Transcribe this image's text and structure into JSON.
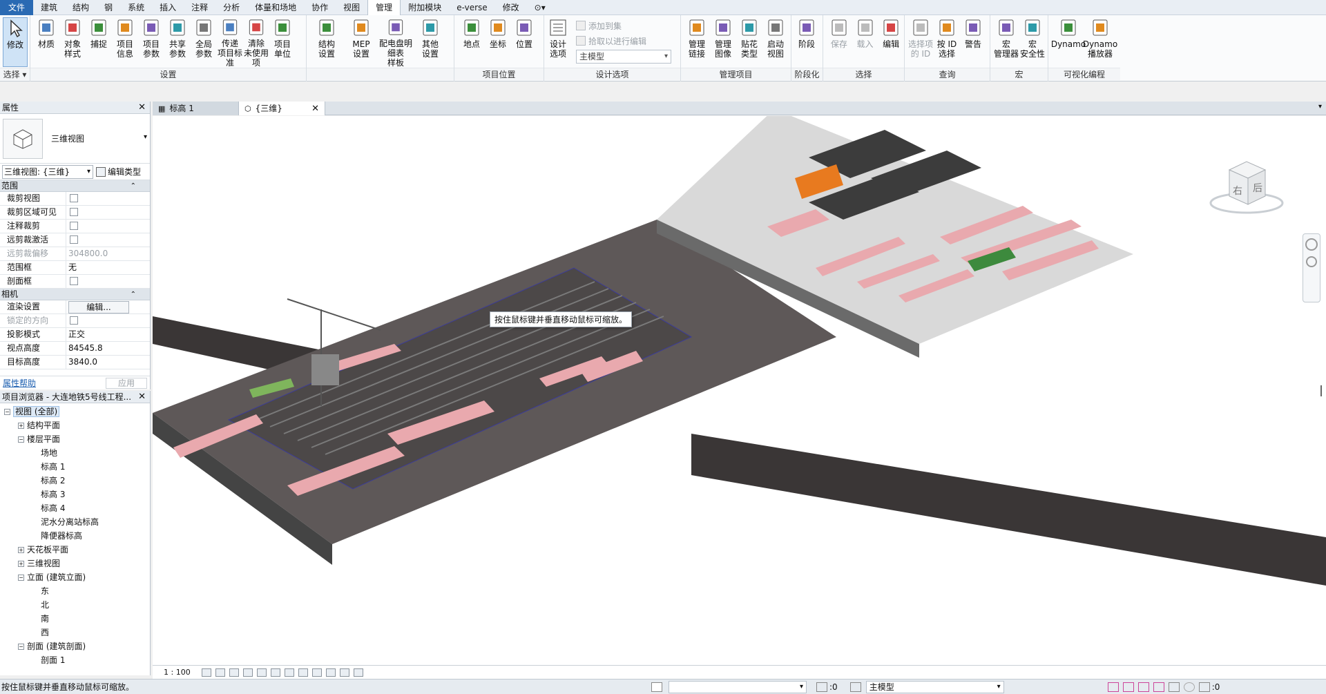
{
  "menu": [
    "文件",
    "建筑",
    "结构",
    "钢",
    "系统",
    "插入",
    "注释",
    "分析",
    "体量和场地",
    "协作",
    "视图",
    "管理",
    "附加模块",
    "e-verse",
    "修改"
  ],
  "menu_active": "管理",
  "ribbon": {
    "select_panel": {
      "tool": "修改",
      "title": "选择"
    },
    "settings_panel": {
      "title": "设置",
      "tools": [
        "材质",
        "对象\n样式",
        "捕捉",
        "项目\n信息",
        "项目\n参数",
        "共享\n参数",
        "全局\n参数",
        "传递\n项目标准",
        "清除\n未使用项",
        "项目\n单位"
      ]
    },
    "mep_panel": {
      "tools": [
        "结构\n设置",
        "MEP\n设置",
        "配电盘明细表\n样板",
        "其他\n设置"
      ]
    },
    "location_panel": {
      "title": "项目位置",
      "tools": [
        "地点",
        "坐标",
        "位置"
      ]
    },
    "design_panel": {
      "title": "设计选项",
      "tool": "设计\n选项",
      "add_to_set": "添加到集",
      "pick_to_edit": "拾取以进行编辑",
      "main_model": "主模型"
    },
    "manage_project_panel": {
      "title": "管理项目",
      "tools": [
        "管理\n链接",
        "管理\n图像",
        "贴花\n类型",
        "启动\n视图"
      ]
    },
    "phasing_panel": {
      "title": "阶段化",
      "tools": [
        "阶段"
      ]
    },
    "selection_panel": {
      "title": "选择",
      "tools": [
        "保存",
        "载入",
        "编辑"
      ]
    },
    "inquiry_panel": {
      "title": "查询",
      "tools": [
        "选择项\n的 ID",
        "按 ID\n选择",
        "警告"
      ]
    },
    "macros_panel": {
      "title": "宏",
      "tools": [
        "宏\n管理器",
        "宏\n安全性"
      ]
    },
    "dynamo_panel": {
      "title": "可视化编程",
      "tools": [
        "Dynamo",
        "Dynamo\n播放器"
      ]
    }
  },
  "properties": {
    "title": "属性",
    "type_name": "三维视图",
    "view_selector": "三维视图: {三维}",
    "edit_type": "编辑类型",
    "group_extents": "范围",
    "extents_rows": [
      {
        "k": "裁剪视图",
        "v": "",
        "cb": true
      },
      {
        "k": "裁剪区域可见",
        "v": "",
        "cb": true
      },
      {
        "k": "注释裁剪",
        "v": "",
        "cb": true
      },
      {
        "k": "远剪裁激活",
        "v": "",
        "cb": true
      },
      {
        "k": "远剪裁偏移",
        "v": "304800.0",
        "dis": true
      },
      {
        "k": "范围框",
        "v": "无"
      },
      {
        "k": "剖面框",
        "v": "",
        "cb": true
      }
    ],
    "group_camera": "相机",
    "render_label": "渲染设置",
    "render_btn": "编辑...",
    "camera_rows": [
      {
        "k": "锁定的方向",
        "v": "",
        "cb": true,
        "dis": true
      },
      {
        "k": "投影模式",
        "v": "正交"
      },
      {
        "k": "视点高度",
        "v": "84545.8"
      },
      {
        "k": "目标高度",
        "v": "3840.0"
      }
    ],
    "help": "属性帮助",
    "apply": "应用"
  },
  "browser": {
    "title": "项目浏览器 - 大连地铁5号线工程...",
    "items": [
      {
        "t": "视图 (全部)",
        "lvl": 0,
        "tog": "−",
        "hl": true
      },
      {
        "t": "结构平面",
        "lvl": 1,
        "tog": "+"
      },
      {
        "t": "楼层平面",
        "lvl": 1,
        "tog": "−"
      },
      {
        "t": "场地",
        "lvl": 2
      },
      {
        "t": "标高 1",
        "lvl": 2
      },
      {
        "t": "标高 2",
        "lvl": 2
      },
      {
        "t": "标高 3",
        "lvl": 2
      },
      {
        "t": "标高 4",
        "lvl": 2
      },
      {
        "t": "泥水分离站标高",
        "lvl": 2
      },
      {
        "t": "降便器标高",
        "lvl": 2
      },
      {
        "t": "天花板平面",
        "lvl": 1,
        "tog": "+"
      },
      {
        "t": "三维视图",
        "lvl": 1,
        "tog": "+"
      },
      {
        "t": "立面 (建筑立面)",
        "lvl": 1,
        "tog": "−"
      },
      {
        "t": "东",
        "lvl": 2
      },
      {
        "t": "北",
        "lvl": 2
      },
      {
        "t": "南",
        "lvl": 2
      },
      {
        "t": "西",
        "lvl": 2
      },
      {
        "t": "剖面 (建筑剖面)",
        "lvl": 1,
        "tog": "−"
      },
      {
        "t": "剖面 1",
        "lvl": 2
      }
    ]
  },
  "tabs": [
    {
      "label": "标高 1",
      "active": false
    },
    {
      "label": "{三维}",
      "active": true
    }
  ],
  "viewport": {
    "tooltip": "按住鼠标键并垂直移动鼠标可缩放。",
    "viewcube_left": "右",
    "viewcube_right": "后"
  },
  "view_scale": "1 : 100",
  "status": {
    "text": "按住鼠标键并垂直移动鼠标可缩放。",
    "count": ":0",
    "model": "主模型",
    "filter_count": ":0"
  },
  "colors": {
    "ground": "#5e5858",
    "roof_pink": "#e9a9ae",
    "accent_orange": "#e87a1f",
    "selection_blue": "#2a6ab3"
  }
}
